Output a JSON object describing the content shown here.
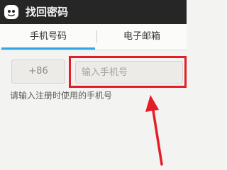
{
  "header": {
    "title": "找回密码",
    "icon": "qq-penguin-icon"
  },
  "tabs": [
    {
      "label": "手机号码",
      "active": true
    },
    {
      "label": "电子邮箱",
      "active": false
    }
  ],
  "form": {
    "country_code": "+86",
    "phone_placeholder": "输入手机号",
    "phone_value": "",
    "hint": "请输入注册时使用的手机号"
  },
  "annotation": {
    "highlight_color": "#e41e26",
    "accent_color": "#2fa6e6"
  }
}
